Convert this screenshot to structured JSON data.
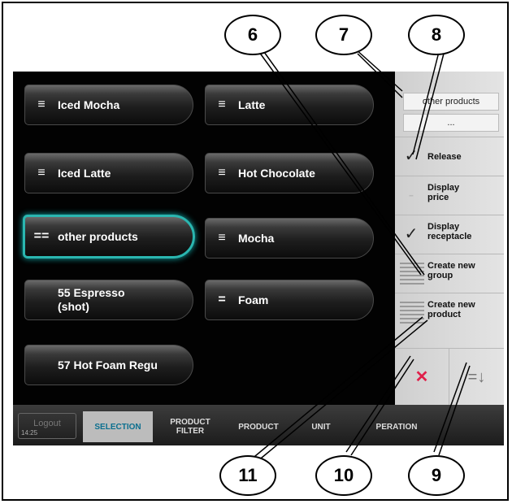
{
  "products": [
    {
      "label": "Iced Mocha",
      "icon": "single-entry-icon",
      "glyph": "≡"
    },
    {
      "label": "Latte",
      "icon": "single-entry-icon",
      "glyph": "≡"
    },
    {
      "label": "Iced Latte",
      "icon": "single-entry-icon",
      "glyph": "≡"
    },
    {
      "label": "Hot Chocolate",
      "icon": "single-entry-icon",
      "glyph": "≡"
    },
    {
      "label": "other products",
      "icon": "group-icon",
      "glyph": "==",
      "selected": true
    },
    {
      "label": "Mocha",
      "icon": "single-entry-icon",
      "glyph": "≡"
    },
    {
      "label": "55 Espresso\n(shot)"
    },
    {
      "label": "Foam",
      "icon": "equals-icon",
      "glyph": "="
    },
    {
      "label": "57 Hot Foam Regu"
    }
  ],
  "right_panel": {
    "group_name": "other products",
    "group_sub": "...",
    "release_label": "Release",
    "display_price_label": "Display\nprice",
    "display_receptacle_label": "Display\nreceptacle",
    "create_group_label": "Create new\ngroup",
    "create_product_label": "Create new\nproduct",
    "delete_glyph": "✕",
    "sort_glyph": "=↓",
    "release_checked": true,
    "display_price_checked": false,
    "display_receptacle_checked": true
  },
  "tabs": {
    "logout": "Logout",
    "time": "14:25",
    "selection": "SELECTION",
    "product_filter": "PRODUCT\nFILTER",
    "product": "PRODUCT",
    "unit": "UNIT",
    "operation": "PERATION"
  },
  "callouts": {
    "c6": "6",
    "c7": "7",
    "c8": "8",
    "c9": "9",
    "c10": "10",
    "c11": "11"
  },
  "colors": {
    "selected_border": "#2ab6b0",
    "delete_red": "#e0204a",
    "active_tab_text": "#0b6f8f"
  }
}
